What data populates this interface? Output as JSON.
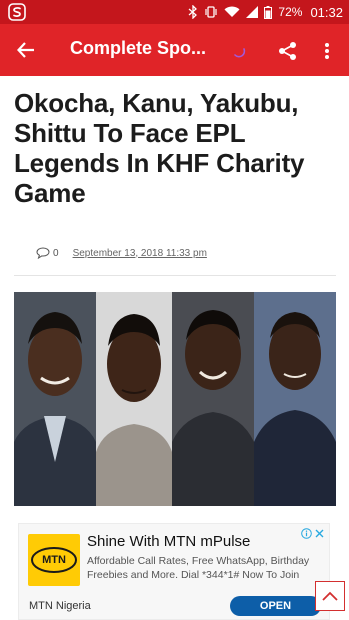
{
  "status_bar": {
    "battery_percent": "72%",
    "time": "01:32",
    "icons": [
      "bluetooth-icon",
      "vibrate-icon",
      "wifi-icon",
      "signal-icon",
      "battery-icon"
    ]
  },
  "app_bar": {
    "title": "Complete Spo...",
    "icons": {
      "back": "arrow-back-icon",
      "share": "share-icon",
      "more": "more-vert-icon"
    }
  },
  "article": {
    "title": "Okocha, Kanu, Yakubu, Shittu To Face EPL Legends In KHF Charity Game",
    "comment_count": "0",
    "date": "September 13, 2018 11:33 pm"
  },
  "ad": {
    "logo_text": "MTN",
    "title": "Shine With MTN mPulse",
    "description": "Affordable Call Rates, Free WhatsApp, Birthday Freebies and More. Dial *344*1# Now To Join",
    "advertiser": "MTN Nigeria",
    "cta": "OPEN"
  },
  "colors": {
    "status_bar": "#c4161c",
    "app_bar": "#e02428",
    "mtn_yellow": "#ffcb05",
    "cta_blue": "#0d5ea8"
  }
}
